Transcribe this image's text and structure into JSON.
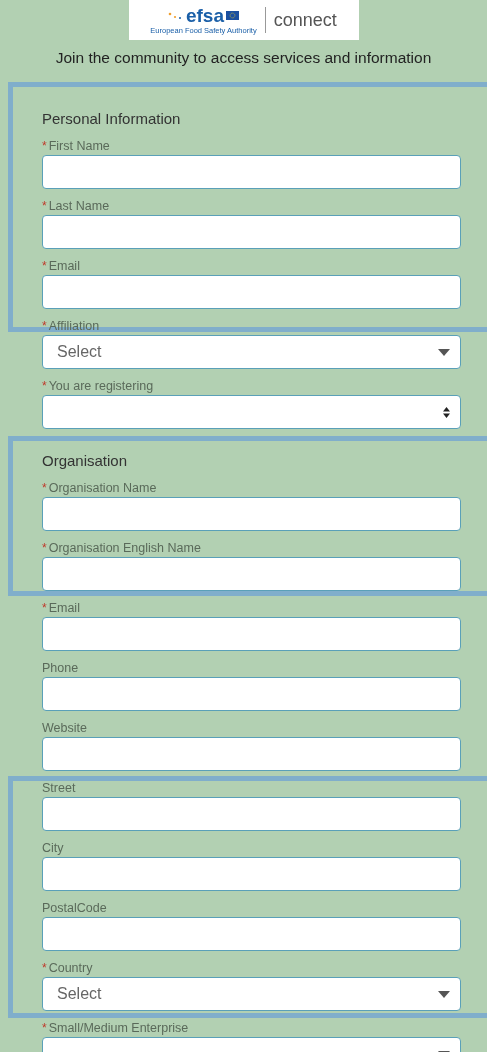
{
  "logo": {
    "wordmark": "efsa",
    "tagline": "European Food Safety Authority",
    "product": "connect"
  },
  "intro": "Join the community to access services and information",
  "form": [
    {
      "kind": "heading",
      "label": "Personal Information"
    },
    {
      "kind": "text",
      "label": "First Name",
      "mark": "*"
    },
    {
      "kind": "text",
      "label": "Last Name",
      "mark": "*"
    },
    {
      "kind": "text",
      "label": "Email",
      "mark": "*"
    },
    {
      "kind": "select",
      "label": "Affiliation",
      "mark": "*",
      "placeholder": "Select"
    },
    {
      "kind": "spinner",
      "label": "You are registering",
      "mark": "*"
    },
    {
      "kind": "heading",
      "label": "Organisation"
    },
    {
      "kind": "text",
      "label": "Organisation Name",
      "mark": "*"
    },
    {
      "kind": "text",
      "label": "Organisation English Name",
      "mark": "*"
    },
    {
      "kind": "text",
      "label": "Email",
      "mark": "*"
    },
    {
      "kind": "text",
      "label": "Phone"
    },
    {
      "kind": "text",
      "label": "Website"
    },
    {
      "kind": "text",
      "label": "Street"
    },
    {
      "kind": "text",
      "label": "City"
    },
    {
      "kind": "text",
      "label": "PostalCode"
    },
    {
      "kind": "select",
      "label": "Country",
      "mark": "*",
      "placeholder": "Select"
    },
    {
      "kind": "select",
      "label": "Small/Medium Enterprise",
      "mark": "*"
    }
  ]
}
